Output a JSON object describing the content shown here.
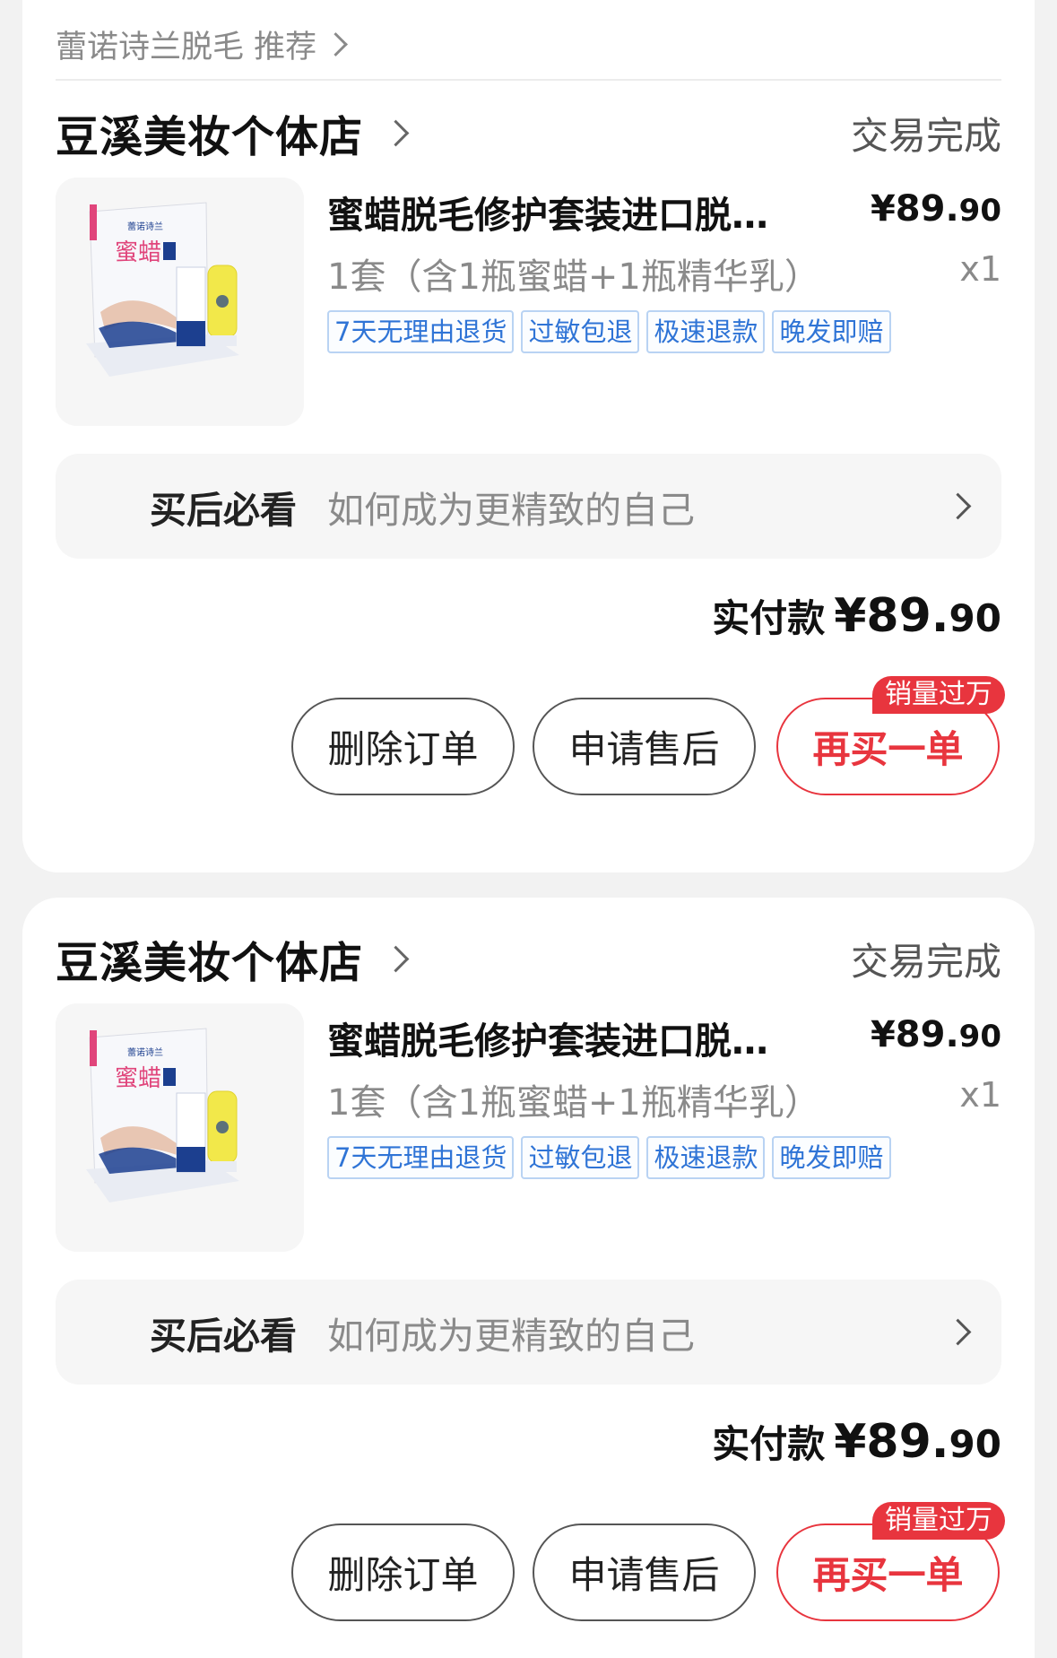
{
  "recommend": {
    "label": "蕾诺诗兰脱毛 推荐"
  },
  "orders": [
    {
      "store_name": "豆溪美妆个体店",
      "status": "交易完成",
      "product": {
        "title": "蜜蜡脱毛修护套装进口脱…",
        "price_main": "¥89.",
        "price_cents": "90",
        "spec": "1套（含1瓶蜜蜡+1瓶精华乳）",
        "qty": "x1",
        "tags": [
          "7天无理由退货",
          "过敏包退",
          "极速退款",
          "晚发即赔"
        ]
      },
      "guide": {
        "label": "买后必看",
        "text": "如何成为更精致的自己"
      },
      "total": {
        "label": "实付款",
        "amount_main": "¥89.",
        "amount_cents": "90"
      },
      "buttons": {
        "delete": "删除订单",
        "after_sale": "申请售后",
        "rebuy": "再买一单",
        "badge": "销量过万"
      }
    },
    {
      "store_name": "豆溪美妆个体店",
      "status": "交易完成",
      "product": {
        "title": "蜜蜡脱毛修护套装进口脱…",
        "price_main": "¥89.",
        "price_cents": "90",
        "spec": "1套（含1瓶蜜蜡+1瓶精华乳）",
        "qty": "x1",
        "tags": [
          "7天无理由退货",
          "过敏包退",
          "极速退款",
          "晚发即赔"
        ]
      },
      "guide": {
        "label": "买后必看",
        "text": "如何成为更精致的自己"
      },
      "total": {
        "label": "实付款",
        "amount_main": "¥89.",
        "amount_cents": "90"
      },
      "buttons": {
        "delete": "删除订单",
        "after_sale": "申请售后",
        "rebuy": "再买一单",
        "badge": "销量过万"
      }
    }
  ],
  "product_image": {
    "brand_text": "蕾诺诗兰",
    "box_title": "蜜蜡",
    "colors": {
      "box": "#f7f8fb",
      "blue": "#1c3f8f",
      "pink": "#e0457b",
      "tube": "#f2e84a"
    }
  }
}
